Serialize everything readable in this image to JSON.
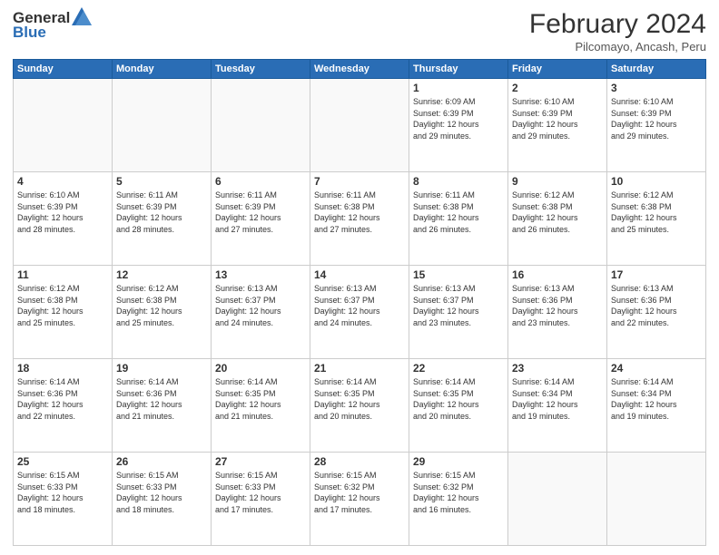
{
  "header": {
    "logo_general": "General",
    "logo_blue": "Blue",
    "title": "February 2024",
    "location": "Pilcomayo, Ancash, Peru"
  },
  "days_of_week": [
    "Sunday",
    "Monday",
    "Tuesday",
    "Wednesday",
    "Thursday",
    "Friday",
    "Saturday"
  ],
  "weeks": [
    [
      {
        "day": "",
        "info": ""
      },
      {
        "day": "",
        "info": ""
      },
      {
        "day": "",
        "info": ""
      },
      {
        "day": "",
        "info": ""
      },
      {
        "day": "1",
        "info": "Sunrise: 6:09 AM\nSunset: 6:39 PM\nDaylight: 12 hours\nand 29 minutes."
      },
      {
        "day": "2",
        "info": "Sunrise: 6:10 AM\nSunset: 6:39 PM\nDaylight: 12 hours\nand 29 minutes."
      },
      {
        "day": "3",
        "info": "Sunrise: 6:10 AM\nSunset: 6:39 PM\nDaylight: 12 hours\nand 29 minutes."
      }
    ],
    [
      {
        "day": "4",
        "info": "Sunrise: 6:10 AM\nSunset: 6:39 PM\nDaylight: 12 hours\nand 28 minutes."
      },
      {
        "day": "5",
        "info": "Sunrise: 6:11 AM\nSunset: 6:39 PM\nDaylight: 12 hours\nand 28 minutes."
      },
      {
        "day": "6",
        "info": "Sunrise: 6:11 AM\nSunset: 6:39 PM\nDaylight: 12 hours\nand 27 minutes."
      },
      {
        "day": "7",
        "info": "Sunrise: 6:11 AM\nSunset: 6:38 PM\nDaylight: 12 hours\nand 27 minutes."
      },
      {
        "day": "8",
        "info": "Sunrise: 6:11 AM\nSunset: 6:38 PM\nDaylight: 12 hours\nand 26 minutes."
      },
      {
        "day": "9",
        "info": "Sunrise: 6:12 AM\nSunset: 6:38 PM\nDaylight: 12 hours\nand 26 minutes."
      },
      {
        "day": "10",
        "info": "Sunrise: 6:12 AM\nSunset: 6:38 PM\nDaylight: 12 hours\nand 25 minutes."
      }
    ],
    [
      {
        "day": "11",
        "info": "Sunrise: 6:12 AM\nSunset: 6:38 PM\nDaylight: 12 hours\nand 25 minutes."
      },
      {
        "day": "12",
        "info": "Sunrise: 6:12 AM\nSunset: 6:38 PM\nDaylight: 12 hours\nand 25 minutes."
      },
      {
        "day": "13",
        "info": "Sunrise: 6:13 AM\nSunset: 6:37 PM\nDaylight: 12 hours\nand 24 minutes."
      },
      {
        "day": "14",
        "info": "Sunrise: 6:13 AM\nSunset: 6:37 PM\nDaylight: 12 hours\nand 24 minutes."
      },
      {
        "day": "15",
        "info": "Sunrise: 6:13 AM\nSunset: 6:37 PM\nDaylight: 12 hours\nand 23 minutes."
      },
      {
        "day": "16",
        "info": "Sunrise: 6:13 AM\nSunset: 6:36 PM\nDaylight: 12 hours\nand 23 minutes."
      },
      {
        "day": "17",
        "info": "Sunrise: 6:13 AM\nSunset: 6:36 PM\nDaylight: 12 hours\nand 22 minutes."
      }
    ],
    [
      {
        "day": "18",
        "info": "Sunrise: 6:14 AM\nSunset: 6:36 PM\nDaylight: 12 hours\nand 22 minutes."
      },
      {
        "day": "19",
        "info": "Sunrise: 6:14 AM\nSunset: 6:36 PM\nDaylight: 12 hours\nand 21 minutes."
      },
      {
        "day": "20",
        "info": "Sunrise: 6:14 AM\nSunset: 6:35 PM\nDaylight: 12 hours\nand 21 minutes."
      },
      {
        "day": "21",
        "info": "Sunrise: 6:14 AM\nSunset: 6:35 PM\nDaylight: 12 hours\nand 20 minutes."
      },
      {
        "day": "22",
        "info": "Sunrise: 6:14 AM\nSunset: 6:35 PM\nDaylight: 12 hours\nand 20 minutes."
      },
      {
        "day": "23",
        "info": "Sunrise: 6:14 AM\nSunset: 6:34 PM\nDaylight: 12 hours\nand 19 minutes."
      },
      {
        "day": "24",
        "info": "Sunrise: 6:14 AM\nSunset: 6:34 PM\nDaylight: 12 hours\nand 19 minutes."
      }
    ],
    [
      {
        "day": "25",
        "info": "Sunrise: 6:15 AM\nSunset: 6:33 PM\nDaylight: 12 hours\nand 18 minutes."
      },
      {
        "day": "26",
        "info": "Sunrise: 6:15 AM\nSunset: 6:33 PM\nDaylight: 12 hours\nand 18 minutes."
      },
      {
        "day": "27",
        "info": "Sunrise: 6:15 AM\nSunset: 6:33 PM\nDaylight: 12 hours\nand 17 minutes."
      },
      {
        "day": "28",
        "info": "Sunrise: 6:15 AM\nSunset: 6:32 PM\nDaylight: 12 hours\nand 17 minutes."
      },
      {
        "day": "29",
        "info": "Sunrise: 6:15 AM\nSunset: 6:32 PM\nDaylight: 12 hours\nand 16 minutes."
      },
      {
        "day": "",
        "info": ""
      },
      {
        "day": "",
        "info": ""
      }
    ]
  ]
}
